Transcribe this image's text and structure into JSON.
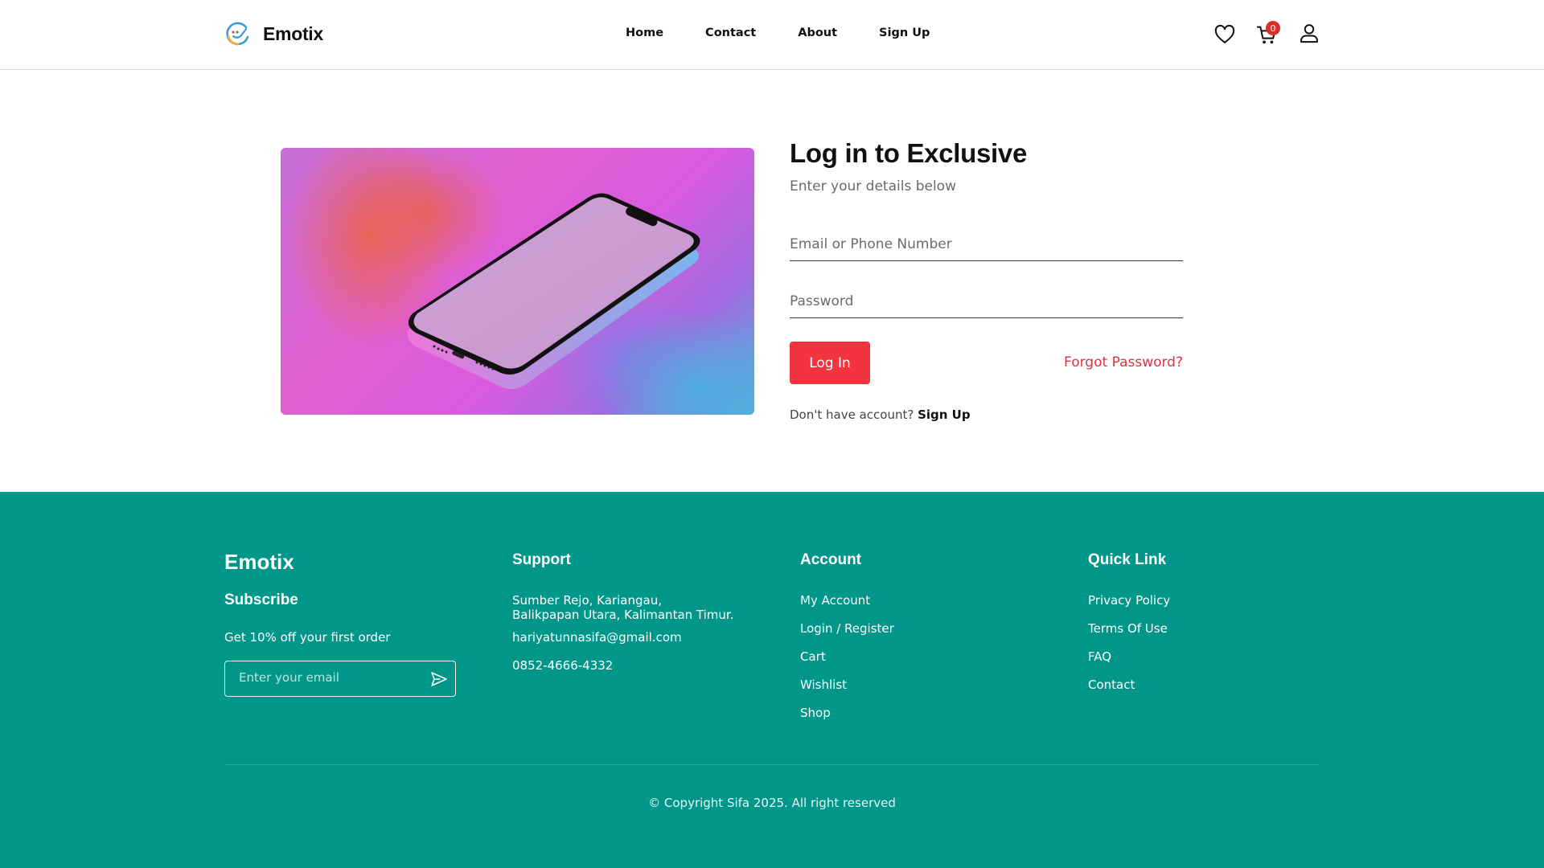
{
  "header": {
    "brand": "Emotix",
    "nav": [
      "Home",
      "Contact",
      "About",
      "Sign Up"
    ],
    "cart_count": "0",
    "icons": [
      "heart-icon",
      "cart-icon",
      "user-icon"
    ]
  },
  "login": {
    "title": "Log in to Exclusive",
    "subtitle": "Enter your details below",
    "email_placeholder": "Email or Phone Number",
    "password_placeholder": "Password",
    "login_label": "Log In",
    "forgot_label": "Forgot Password?",
    "no_account_text": "Don't have account?",
    "signup_label": "Sign Up"
  },
  "footer": {
    "brand": "Emotix",
    "subscribe_title": "Subscribe",
    "subscribe_text": "Get 10% off your first order",
    "email_placeholder": "Enter your email",
    "support": {
      "title": "Support",
      "address_line1": "Sumber Rejo, Kariangau,",
      "address_line2": "Balikpapan Utara, Kalimantan Timur.",
      "email": "hariyatunnasifa@gmail.com",
      "phone": "0852-4666-4332"
    },
    "account": {
      "title": "Account",
      "items": [
        "My Account",
        "Login / Register",
        "Cart",
        "Wishlist",
        "Shop"
      ]
    },
    "quick_link": {
      "title": "Quick Link",
      "items": [
        "Privacy Policy",
        "Terms Of Use",
        "FAQ",
        "Contact"
      ]
    },
    "copyright": "© Copyright Sifa 2025. All right reserved"
  },
  "colors": {
    "accent_red": "#f2343f",
    "footer_bg": "#00968a",
    "badge_red": "#db2d2d"
  }
}
